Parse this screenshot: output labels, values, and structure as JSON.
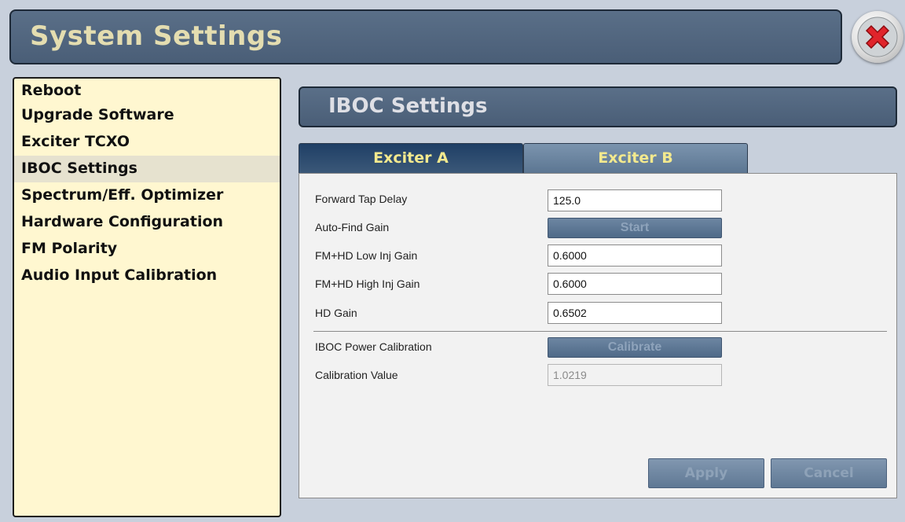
{
  "window": {
    "title": "System Settings"
  },
  "sidebar": {
    "items": [
      {
        "label": "Reboot"
      },
      {
        "label": "Upgrade Software"
      },
      {
        "label": "Exciter TCXO"
      },
      {
        "label": "IBOC Settings",
        "selected": true
      },
      {
        "label": "Spectrum/Eff. Optimizer"
      },
      {
        "label": "Hardware Configuration"
      },
      {
        "label": "FM Polarity"
      },
      {
        "label": "Audio Input Calibration"
      }
    ]
  },
  "main": {
    "section_title": "IBOC Settings",
    "tabs": [
      {
        "label": "Exciter A",
        "active": true
      },
      {
        "label": "Exciter B",
        "active": false
      }
    ],
    "fields": {
      "forward_tap_delay": {
        "label": "Forward Tap Delay",
        "value": "125.0"
      },
      "auto_find_gain": {
        "label": "Auto-Find Gain",
        "button": "Start"
      },
      "fm_hd_low_inj_gain": {
        "label": "FM+HD Low Inj Gain",
        "value": "0.6000"
      },
      "fm_hd_high_inj_gain": {
        "label": "FM+HD High Inj Gain",
        "value": "0.6000"
      },
      "hd_gain": {
        "label": "HD Gain",
        "value": "0.6502"
      },
      "iboc_power_calibration": {
        "label": "IBOC Power Calibration",
        "button": "Calibrate"
      },
      "calibration_value": {
        "label": "Calibration Value",
        "value": "1.0219"
      }
    },
    "actions": {
      "apply": "Apply",
      "cancel": "Cancel"
    }
  },
  "icons": {
    "close": "close-icon"
  },
  "colors": {
    "title_text": "#e4ddb0",
    "tab_text": "#f3e98e",
    "close_red": "#e0242b"
  }
}
